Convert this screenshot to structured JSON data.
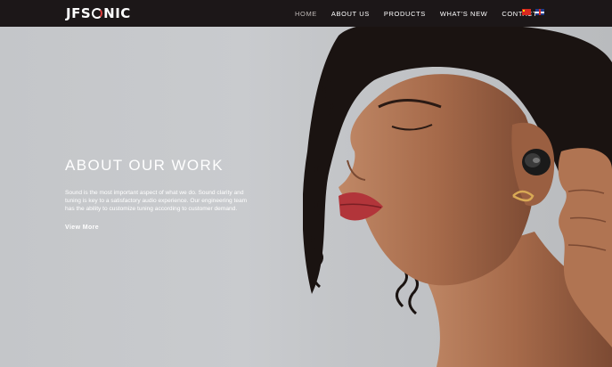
{
  "brand": {
    "logo_prefix": "JFS",
    "logo_suffix": "NIC"
  },
  "nav": {
    "items": [
      {
        "label": "HOME"
      },
      {
        "label": "ABOUT US"
      },
      {
        "label": "PRODUCTS"
      },
      {
        "label": "WHAT'S NEW"
      },
      {
        "label": "CONTACT"
      }
    ],
    "active": "HOME"
  },
  "hero": {
    "headline": "ABOUT OUR WORK",
    "body": "Sound is the most important aspect of what we do. Sound clarity and tuning is key to a satisfactory audio experience. Our engineering team has the ability to customize tuning according to customer demand.",
    "cta": "View More"
  },
  "colors": {
    "navbar": "#1c1718",
    "text": "#ffffff",
    "accent": "#d83a3a"
  }
}
